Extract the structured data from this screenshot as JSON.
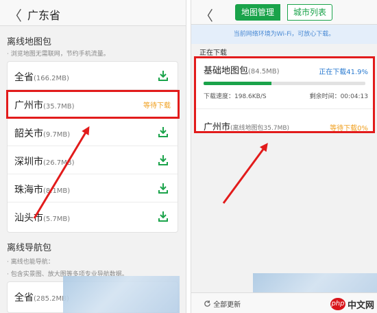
{
  "left": {
    "back_glyph": "〈",
    "title": "广东省",
    "offline_map": {
      "heading": "离线地图包",
      "note": "· 浏览地图无需联网，节约手机流量。",
      "rows": [
        {
          "name": "全省",
          "size": "(166.2MB)"
        },
        {
          "name": "广州市",
          "size": "(35.7MB)",
          "status": "等待下载"
        },
        {
          "name": "韶关市",
          "size": "(9.7MB)"
        },
        {
          "name": "深圳市",
          "size": "(26.7MB)"
        },
        {
          "name": "珠海市",
          "size": "(8.1MB)"
        },
        {
          "name": "汕头市",
          "size": "(5.7MB)"
        }
      ]
    },
    "offline_nav": {
      "heading": "离线导航包",
      "note1": "· 离线也能导航：",
      "note2": "· 包含实景图、放大图等多项专业导航数据。",
      "row": {
        "name": "全省",
        "size": "(285.2MB)"
      }
    }
  },
  "right": {
    "back_glyph": "〈",
    "tabs": {
      "active": "地图管理",
      "inactive": "城市列表"
    },
    "wifi_notice": "当前网络环境为Wi-Fi，可放心下载。",
    "downloading_heading": "正在下载",
    "base_pack": {
      "name": "基础地图包",
      "size": "(84.5MB)",
      "status": "正在下载41.9%",
      "progress": 0.419,
      "speed": "下载速度：198.6KB/S",
      "remaining": "剩余时间：00:04:13"
    },
    "gz_pack": {
      "name": "广州市",
      "size": "(离线地图包35.7MB)",
      "status": "等待下载0%"
    },
    "update_all": "全部更新"
  },
  "watermark": {
    "logo": "php",
    "text": "中文网"
  },
  "colors": {
    "accent_green": "#1aa34a",
    "highlight_red": "#e21b1b",
    "pending_orange": "#f0a020",
    "downloading_blue": "#2b7bd0"
  },
  "icons": [
    "back-icon",
    "download-icon",
    "refresh-icon"
  ]
}
